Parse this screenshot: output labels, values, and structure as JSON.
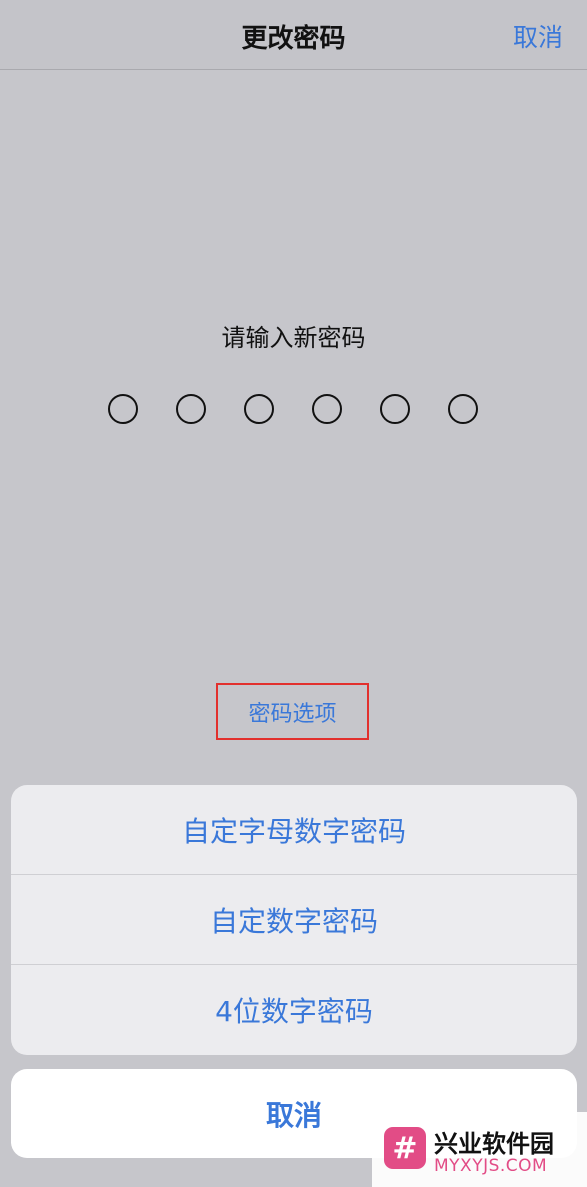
{
  "nav": {
    "title": "更改密码",
    "cancel_label": "取消"
  },
  "passcode": {
    "prompt": "请输入新密码",
    "digits_total": 6,
    "digits_entered": 0
  },
  "options_link": {
    "label": "密码选项"
  },
  "action_sheet": {
    "items": [
      {
        "label": "自定字母数字密码"
      },
      {
        "label": "自定数字密码"
      },
      {
        "label": "4位数字密码"
      }
    ],
    "cancel_label": "取消"
  },
  "watermark": {
    "logo_glyph": "#",
    "name": "兴业软件园",
    "url": "MYXYJS.COM"
  },
  "colors": {
    "accent": "#3a78d9",
    "highlight_box": "#e2302d",
    "background": "#c6c6cb",
    "watermark_brand": "#e24c86"
  }
}
